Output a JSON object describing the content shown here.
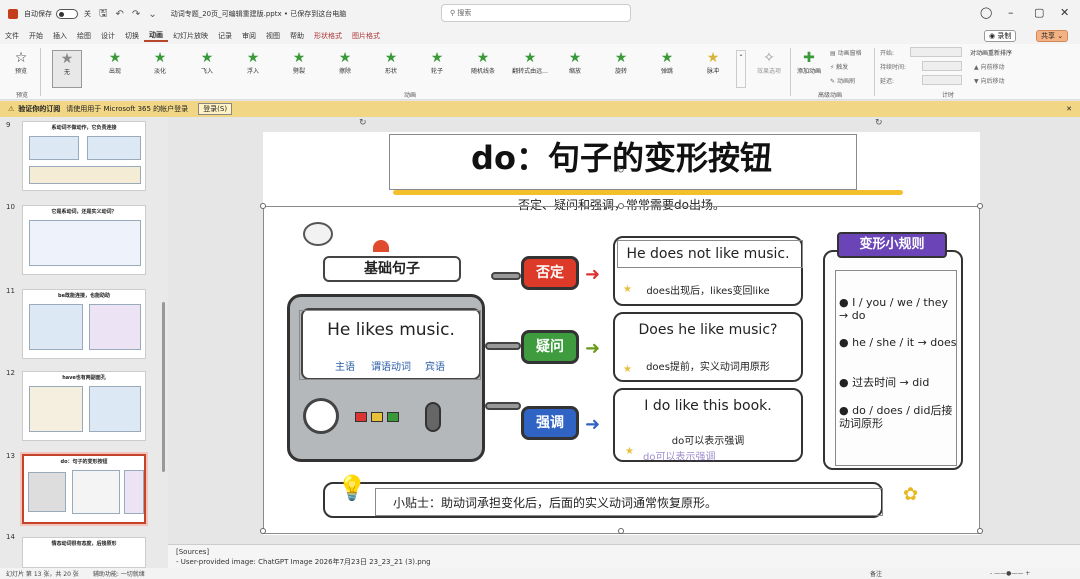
{
  "titlebar": {
    "autosave": "自动保存",
    "toggle": "关",
    "filename": "动词专题_20页_可编辑重建版.pptx • 已保存到这台电脑",
    "search": "搜索"
  },
  "menu": [
    "文件",
    "开始",
    "插入",
    "绘图",
    "设计",
    "切换",
    "动画",
    "幻灯片放映",
    "记录",
    "审阅",
    "视图",
    "帮助",
    "形状格式",
    "图片格式"
  ],
  "record": "录制",
  "share": "共享",
  "ribbon": {
    "preview": "预览",
    "effects": [
      "无",
      "出现",
      "淡化",
      "飞入",
      "浮入",
      "劈裂",
      "擦除",
      "形状",
      "轮子",
      "随机线条",
      "翻转式由远...",
      "缩放",
      "旋转",
      "弹跳",
      "脉冲"
    ],
    "effect_options": "效果选项",
    "add_anim": "添加动画",
    "pane": "动画窗格",
    "trigger": "触发",
    "painter": "动画刷",
    "start": "开始:",
    "duration": "持续时间:",
    "delay": "延迟:",
    "reorder": "对动画重新排序",
    "fwd": "向前移动",
    "back": "向后移动",
    "groups": [
      "预览",
      "动画",
      "高级动画",
      "计时"
    ]
  },
  "notice": {
    "title": "验证你的订阅",
    "text": "请使用用于 Microsoft 365 的帐户登录",
    "btn": "登录(S)"
  },
  "slides": [
    {
      "num": "9",
      "title": "系动词不做动作，它负责连接"
    },
    {
      "num": "10",
      "title": "它是系动词，还是实义动词？"
    },
    {
      "num": "11",
      "title": "be既能连接，也能助助"
    },
    {
      "num": "12",
      "title": "have也有两副面孔"
    },
    {
      "num": "13",
      "title": "do：句子的变形按钮"
    },
    {
      "num": "14",
      "title": "情态动词很有态度，后接原形"
    }
  ],
  "slide": {
    "title": "do：句子的变形按钮",
    "subtitle": "否定、疑问和强调，常常需要do出场。",
    "basic": "基础句子",
    "sentence": "He likes music.",
    "tags": [
      "主语",
      "谓语动词",
      "宾语"
    ],
    "btn_neg": "否定",
    "btn_q": "疑问",
    "btn_em": "强调",
    "neg_sent": "He does not like music.",
    "neg_note": "does出现后，likes变回like",
    "q_sent": "Does he like music?",
    "q_note": "does提前，实义动词用原形",
    "em_sent": "I do like this book.",
    "em_note": "do可以表示强调",
    "em_shadow": "do可以表示强调",
    "rules_title": "变形小规则",
    "rules": [
      "● I / you / we / they → do",
      "● he / she / it → does",
      "● 过去时间 → did",
      "● do / does / did后接动词原形"
    ],
    "tip": "小贴士：助动词承担变化后，后面的实义动词通常恢复原形。"
  },
  "notes": {
    "l1": "[Sources]",
    "l2": "- User-provided image: ChatGPT Image 2026年7月23日 23_23_21 (3).png"
  },
  "status": {
    "slide": "幻灯片 第 13 张，共 20 张",
    "access": "辅助功能: 一切就绪",
    "notes_btn": "备注",
    "zoom": "- ——●—— +"
  }
}
